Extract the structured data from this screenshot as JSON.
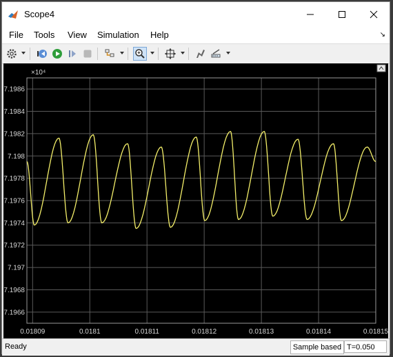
{
  "window": {
    "title": "Scope4"
  },
  "menu": [
    "File",
    "Tools",
    "View",
    "Simulation",
    "Help"
  ],
  "toolbar": {
    "icons": [
      "gear-icon",
      "step-back-icon",
      "run-icon",
      "step-forward-icon",
      "stop-icon",
      "signal-select-icon",
      "zoom-icon",
      "fit-to-view-icon",
      "style-icon",
      "measurements-icon"
    ]
  },
  "plot": {
    "exponent_label": "×10⁴",
    "background": "#000000",
    "trace_color": "#f5f06a",
    "grid_color": "#5a5a5a"
  },
  "chart_data": {
    "type": "line",
    "xlim": [
      0.018089,
      0.01815
    ],
    "ylim": [
      7.1965,
      7.1987
    ],
    "xticks": [
      0.01809,
      0.0181,
      0.01811,
      0.01812,
      0.01813,
      0.01814,
      0.01815
    ],
    "xtick_labels": [
      "0.01809",
      "0.0181",
      "0.01811",
      "0.01812",
      "0.01813",
      "0.01814",
      "0.01815"
    ],
    "yticks": [
      7.1966,
      7.1968,
      7.197,
      7.1972,
      7.1974,
      7.1976,
      7.1978,
      7.198,
      7.1982,
      7.1984,
      7.1986
    ],
    "ytick_labels": [
      "7.1966",
      "7.1968",
      "7.197",
      "7.1972",
      "7.1974",
      "7.1976",
      "7.1978",
      "7.198",
      "7.1982",
      "7.1984",
      "7.1986"
    ],
    "grid": true,
    "series": [
      {
        "x": [
          0.018089,
          0.0180903,
          0.0180946,
          0.0180962,
          0.0181006,
          0.0181021,
          0.0181066,
          0.0181081,
          0.0181125,
          0.0181141,
          0.0181186,
          0.0181201,
          0.0181246,
          0.018126,
          0.0181305,
          0.018132,
          0.0181364,
          0.018138,
          0.0181426,
          0.018144,
          0.0181485,
          0.01815
        ],
        "y": [
          7.19795,
          7.19738,
          7.19816,
          7.1974,
          7.19819,
          7.1974,
          7.19811,
          7.19735,
          7.19808,
          7.19736,
          7.19817,
          7.19742,
          7.19822,
          7.19743,
          7.19822,
          7.19746,
          7.19815,
          7.19743,
          7.19811,
          7.19742,
          7.19808,
          7.19795
        ]
      }
    ]
  },
  "status": {
    "ready": "Ready",
    "mode": "Sample based",
    "time": "T=0.050"
  }
}
